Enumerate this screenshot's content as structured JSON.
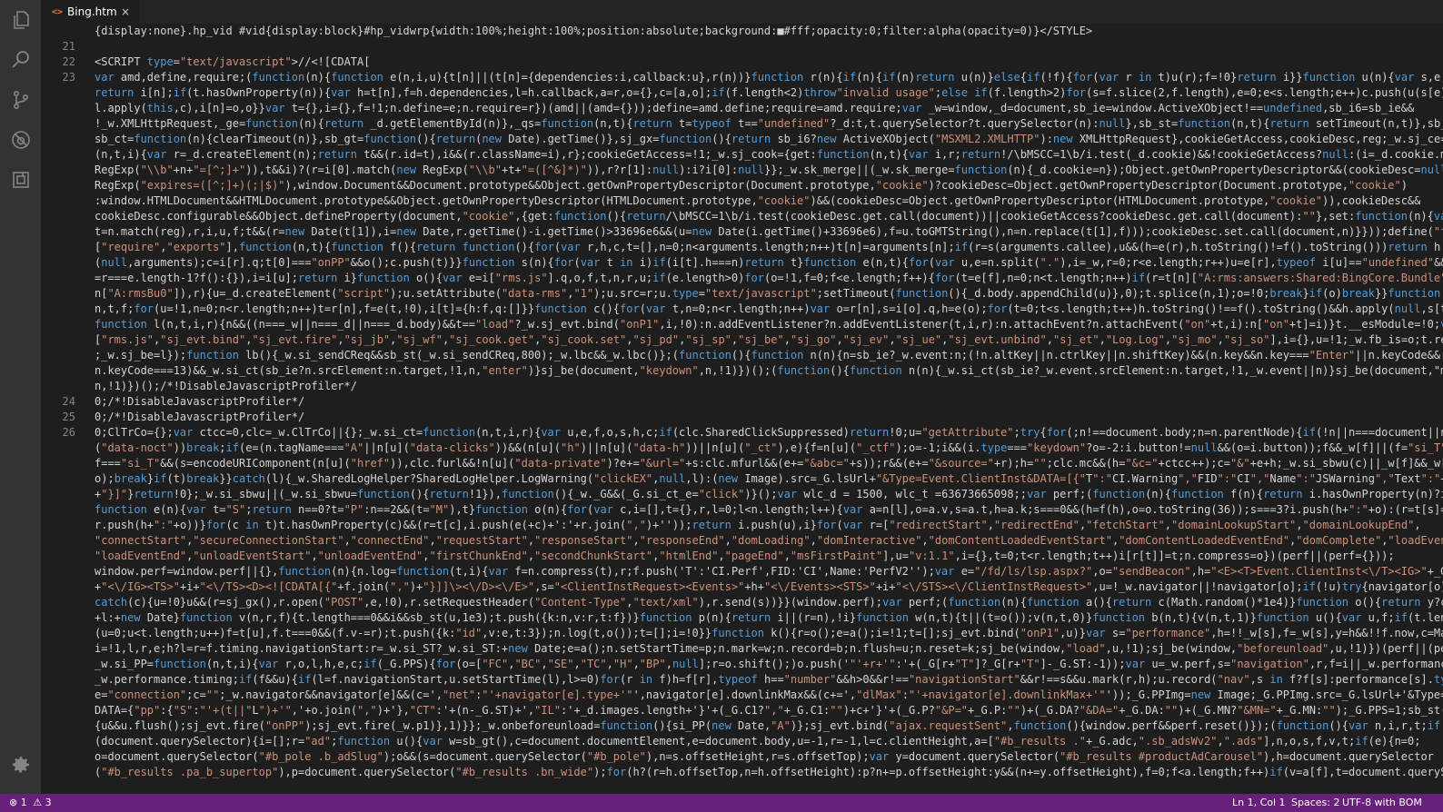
{
  "tab": {
    "file_icon": "<>",
    "name": "Bing.htm",
    "close": "×",
    "active": true
  },
  "activity_bar": {
    "items": [
      {
        "icon": "files-icon"
      },
      {
        "icon": "search-icon"
      },
      {
        "icon": "source-control-icon"
      },
      {
        "icon": "debug-icon"
      },
      {
        "icon": "extensions-icon"
      }
    ],
    "settings_icon": "gear-icon"
  },
  "editor": {
    "line_numbers": [
      "21",
      "22",
      "23",
      "24",
      "25",
      "26"
    ],
    "lines": [
      {
        "no": "",
        "text": "{display:none}.hp_vid #vid{display:block}#hp_vidwrp{width:100%;height:100%;position:absolute;background:■#fff;opacity:0;filter:alpha(opacity=0)}</STYLE>"
      },
      {
        "no": "21",
        "text": ""
      },
      {
        "no": "22",
        "text": "<SCRIPT type=\"text/javascript\">//<![CDATA["
      },
      {
        "no": "23",
        "text": "var amd,define,require;(function(n){function e(n,i,u){t[n]||(t[n]={dependencies:i,callback:u},r(n))}function r(n){if(n){if(n)return u(n)}else{if(!f){for(var r in t)u(r);f=!0}return i}}function u(n){var s,e;if(i[n])"
      },
      {
        "no": "",
        "text": "return i[n];if(t.hasOwnProperty(n)){var h=t[n],f=h.dependencies,l=h.callback,a=r,o={},c=[a,o];if(f.length<2)throw\"invalid usage\";else if(f.length>2)for(s=f.slice(2,f.length),e=0;e<s.length;e++)c.push(u(s[e]));retur"
      },
      {
        "no": "",
        "text": "l.apply(this,c),i[n]=o,o}}var t={},i={},f=!1;n.define=e;n.require=r})(amd||(amd={}));define=amd.define;require=amd.require;var _w=window,_d=document,sb_ie=window.ActiveXObject!==undefined,sb_i6=sb_ie&&"
      },
      {
        "no": "",
        "text": "!_w.XMLHttpRequest,_ge=function(n){return _d.getElementById(n)},_qs=function(n,t){return t=typeof t==\"undefined\"?_d:t,t.querySelector?t.querySelector(n):null},sb_st=function(n,t){return setTimeout(n,t)},sb_rst=sb_"
      },
      {
        "no": "",
        "text": "sb_ct=function(n){clearTimeout(n)},sb_gt=function(){return(new Date).getTime()},sj_gx=function(){return sb_i6?new ActiveXObject(\"MSXML2.XMLHTTP\"):new XMLHttpRequest},cookieGetAccess,cookieDesc,reg;_w.sj_ce=function"
      },
      {
        "no": "",
        "text": "(n,t,i){var r=_d.createElement(n);return t&&(r.id=t),i&&(r.className=i),r};cookieGetAccess=!1;_w.sj_cook={get:function(n,t){var i,r;return!/\\bMSCC=1\\b/i.test(_d.cookie)&&!cookieGetAccess?null:(i=_d.cookie.match(new"
      },
      {
        "no": "",
        "text": "RegExp(\"\\\\b\"+n+\"=[^;]+\")),t&&i)?(r=i[0].match(new RegExp(\"\\\\b\"+t+\"=([^&]*)\")),r?r[1]:null):i?i[0]:null}};_w.sk_merge||(_w.sk_merge=function(n){_d.cookie=n});Object.getOwnPropertyDescriptor&&(cookieDesc=null,reg=new"
      },
      {
        "no": "",
        "text": "RegExp(\"expires=([^;]+)(;|$)\"),window.Document&&Document.prototype&&Object.getOwnPropertyDescriptor(Document.prototype,\"cookie\")?cookieDesc=Object.getOwnPropertyDescriptor(Document.prototype,\"cookie\")"
      },
      {
        "no": "",
        "text": ":window.HTMLDocument&&HTMLDocument.prototype&&Object.getOwnPropertyDescriptor(HTMLDocument.prototype,\"cookie\")&&(cookieDesc=Object.getOwnPropertyDescriptor(HTMLDocument.prototype,\"cookie\")),cookieDesc&&"
      },
      {
        "no": "",
        "text": "cookieDesc.configurable&&Object.defineProperty(document,\"cookie\",{get:function(){return/\\bMSCC=1\\b/i.test(cookieDesc.get.call(document))||cookieGetAccess?cookieDesc.get.call(document):\"\"},set:function(n){var"
      },
      {
        "no": "",
        "text": "t=n.match(reg),r,i,u,f;t&&(r=new Date(t[1]),i=new Date,r.getTime()-i.getTime()>33696e6&&(u=new Date(i.getTime()+33696e6),f=u.toGMTString(),n=n.replace(t[1],f)));cookieDesc.set.call(document,n)}}));define(\"fallback\""
      },
      {
        "no": "",
        "text": "[\"require\",\"exports\"],function(n,t){function f(){return function(){for(var r,h,c,t=[],n=0;n<arguments.length;n++)t[n]=arguments[n];if(r=s(arguments.callee),u&&(h=e(r),h.toString()!=f().toString()))return h.apply"
      },
      {
        "no": "",
        "text": "(null,arguments);c=i[r].q;t[0]===\"onPP\"&&o();c.push(t)}}function s(n){for(var t in i)if(i[t].h===n)return t}function e(n,t){for(var u,e=n.split(\".\"),i=_w,r=0;r<e.length;r++)u=e[r],typeof i[u]==\"undefined\"&&t&&(i[u]"
      },
      {
        "no": "",
        "text": "=r===e.length-1?f():{}),i=i[u];return i}function o(){var e=i[\"rms.js\"].q,o,f,t,n,r,u;if(e.length>0)for(o=!1,f=0;f<e.length;f++){for(t=e[f],n=0;n<t.length;n++)if(r=t[n][\"A:rms:answers:Shared:BingCore.Bundle\"],r||(r="
      },
      {
        "no": "",
        "text": "n[\"A:rmsBu0\"]),r){u=_d.createElement(\"script\");u.setAttribute(\"data-rms\",\"1\");u.src=r;u.type=\"text/javascript\";setTimeout(function(){_d.body.appendChild(u)},0);t.splice(n,1);o=!0;break}if(o)break}}function h(){va"
      },
      {
        "no": "",
        "text": "n,t,f;for(u=!1,n=0;n<r.length;n++)t=r[n],f=e(t,!0),i[t]={h:f,q:[]}}function c(){for(var t,n=0;n<r.length;n++)var o=r[n],s=i[o].q,h=e(o);for(t=0;t<s.length;t++)h.toString()!==f().toString()&&h.apply(null,s[t])}u=!0"
      },
      {
        "no": "",
        "text": "function l(n,t,i,r){n&&((n===_w||n===_d||n===_d.body)&&t==\"load\"?_w.sj_evt.bind(\"onP1\",i,!0):n.addEventListener?n.addEventListener(t,i,r):n.attachEvent?n.attachEvent(\"on\"+t,i):n[\"on\"+t]=i)}t.__esModule=!0;var r="
      },
      {
        "no": "",
        "text": "[\"rms.js\",\"sj_evt.bind\",\"sj_evt.fire\",\"sj_jb\",\"sj_wf\",\"sj_cook.get\",\"sj_cook.set\",\"sj_pd\",\"sj_sp\",\"sj_be\",\"sj_go\",\"sj_ev\",\"sj_ue\",\"sj_evt.unbind\",\"sj_et\",\"Log.Log\",\"sj_mo\",\"sj_so\"],i={},u=!1;_w.fb_is=o;t.replay=c;h"
      },
      {
        "no": "",
        "text": ";_w.sj_be=l});function lb(){_w.si_sendCReq&&sb_st(_w.si_sendCReq,800);_w.lbc&&_w.lbc()};(function(){function n(n){n=sb_ie?_w.event:n;(!n.altKey||n.ctrlKey||n.shiftKey)&&(n.key&&n.key===\"Enter\"||n.keyCode&&"
      },
      {
        "no": "",
        "text": "n.keyCode===13)&&_w.si_ct(sb_ie?n.srcElement:n.target,!1,n,\"enter\")}sj_be(document,\"keydown\",n,!1)})();(function(){function n(n){_w.si_ct(sb_ie?_w.event.srcElement:n.target,!1,_w.event||n)}sj_be(document,\"mousedown"
      },
      {
        "no": "",
        "text": "n,!1)})();/*!DisableJavascriptProfiler*/"
      },
      {
        "no": "24",
        "text": "0;/*!DisableJavascriptProfiler*/"
      },
      {
        "no": "25",
        "text": "0;/*!DisableJavascriptProfiler*/"
      },
      {
        "no": "26",
        "text": "0;ClTrCo={};var ctcc=0,clc=_w.ClTrCo||{};_w.si_ct=function(n,t,i,r){var u,e,f,o,s,h,c;if(clc.SharedClickSuppressed)return!0;u=\"getAttribute\";try{for(;n!==document.body;n=n.parentNode){if(!n||n===document||n[u]"
      },
      {
        "no": "",
        "text": "(\"data-noct\"))break;if(e=(n.tagName===\"A\"||n[u](\"data-clicks\"))&&(n[u](\"h\")||n[u](\"data-h\"))||n[u](\"_ct\"),e){f=n[u](\"_ctf\");o=-1;i&&(i.type===\"keydown\"?o=-2:i.button!=null&&(o=i.button));f&&_w[f]||(f=\"si_T\");"
      },
      {
        "no": "",
        "text": "f===\"si_T\"&&(s=encodeURIComponent(n[u](\"href\")),clc.furl&&!n[u](\"data-private\")?e+=\"&url=\"+s:clc.mfurl&&(e+=\"&abc=\"+s));r&&(e+=\"&source=\"+r);h=\"\";clc.mc&&(h=\"&c=\"+ctcc++);c=\"&\"+e+h;_w.si_sbwu(c)||_w[f]&&_w[f](c,n,i"
      },
      {
        "no": "",
        "text": "o);break}if(t)break}}catch(l){_w.SharedLogHelper?SharedLogHelper.LogWarning(\"clickEX\",null,l):(new Image).src=_G.lsUrl+\"&Type=Event.ClientInst&DATA=[{\"T\":\"CI.Warning\",\"FID\":\"CI\",\"Name\":\"JSWarning\",\"Text\":\"+l.messag"
      },
      {
        "no": "",
        "text": "+\"}]\"}return!0};_w.si_sbwu||(_w.si_sbwu=function(){return!1}),function(){_w._G&&(_G.si_ct_e=\"click\")}();var wlc_d = 1500, wlc_t =63673665098;;var perf;(function(n){function f(n){return i.hasOwnProperty(n)?i[n]:n}"
      },
      {
        "no": "",
        "text": "function e(n){var t=\"S\";return n==0?t=\"P\":n==2&&(t=\"M\"),t}function o(n){for(var c,i=[],t={},r,l=0;l<n.length;l++){var a=n[l],o=a.v,s=a.t,h=a.k;s===0&&(h=f(h),o=o.toString(36));s===3?i.push(h+\":\"+o):(r=t[s]=t[s]||[]"
      },
      {
        "no": "",
        "text": "r.push(h+\":\"+o))}for(c in t)t.hasOwnProperty(c)&&(r=t[c],i.push(e(+c)+':'+r.join(\",\")+''));return i.push(u),i}for(var r=[\"redirectStart\",\"redirectEnd\",\"fetchStart\",\"domainLookupStart\",\"domainLookupEnd\","
      },
      {
        "no": "",
        "text": "\"connectStart\",\"secureConnectionStart\",\"connectEnd\",\"requestStart\",\"responseStart\",\"responseEnd\",\"domLoading\",\"domInteractive\",\"domContentLoadedEventStart\",\"domContentLoadedEventEnd\",\"domComplete\",\"loadEventStart\","
      },
      {
        "no": "",
        "text": "\"loadEventEnd\",\"unloadEventStart\",\"unloadEventEnd\",\"firstChunkEnd\",\"secondChunkStart\",\"htmlEnd\",\"pageEnd\",\"msFirstPaint\"],u=\"v:1.1\",i={},t=0;t<r.length;t++)i[r[t]]=t;n.compress=o})(perf||(perf={}));"
      },
      {
        "no": "",
        "text": "window.perf=window.perf||{},function(n){n.log=function(t,i){var f=n.compress(t),r;f.push('T':'CI.Perf',FID:'CI',Name:'PerfV2'');var e=\"/fd/ls/lsp.aspx?\",o=\"sendBeacon\",h=\"<E><T>Event.ClientInst<\\/T><IG>\"+_G.IG"
      },
      {
        "no": "",
        "text": "+\"<\\/IG><TS>\"+i+\"<\\/TS><D><![CDATA[{\"+f.join(\",\")+\"}]]\\><\\/D><\\/E>\",s=\"<ClientInstRequest><Events>\"+h+\"<\\/Events><STS>\"+i+\"<\\/STS><\\/ClientInstRequest>\",u=!_w.navigator||!navigator[o];if(!u)try{navigator[o](e,s)}"
      },
      {
        "no": "",
        "text": "catch(c){u=!0}u&&(r=sj_gx(),r.open(\"POST\",e,!0),r.setRequestHeader(\"Content-Type\",\"text/xml\"),r.send(s))}}(window.perf);var perf;(function(n){function a(){return c(Math.random()*1e4)}function o(){return y?c(f.now()"
      },
      {
        "no": "",
        "text": "+l:+new Date}function v(n,r,f){t.length===0&&i&&sb_st(u,1e3);t.push({k:n,v:r,t:f})}function p(n){return i||(r=n),!i}function w(n,t){t||(t=o());v(n,t,0)}function b(n,t){v(n,t,1)}function u(){var u,f;if(t.length){fo"
      },
      {
        "no": "",
        "text": "(u=0;u<t.length;u++)f=t[u],f.t===0&&(f.v-=r);t.push({k:\"id\",v:e,t:3});n.log(t,o());t=[];i=!0}}function k(){r=o();e=a();i=!1;t=[];sj_evt.bind(\"onP1\",u)}var s=\"performance\",h=!!_w[s],f=_w[s],y=h&&!!f.now,c=Math.round,t="
      },
      {
        "no": "",
        "text": "i=!1,l,r,e;h?l=r=f.timing.navigationStart:r=_w.si_ST?_w.si_ST:+new Date;e=a();n.setStartTime=p;n.mark=w;n.record=b;n.flush=u;n.reset=k;sj_be(window,\"load\",u,!1);sj_be(window,\"beforeunload\",u,!1)})(perf||(perf={}));"
      },
      {
        "no": "",
        "text": "_w.si_PP=function(n,t,i){var r,o,l,h,e,c;if(_G.PPS){for(o=[\"FC\",\"BC\",\"SE\",\"TC\",\"H\",\"BP\",null];r=o.shift();)o.push('\"'+r+'\":'+(_G[r+\"T\"]?_G[r+\"T\"]-_G.ST:-1));var u=_w.perf,s=\"navigation\",r,f=i||_w.performance&&"
      },
      {
        "no": "",
        "text": "_w.performance.timing;if(f&&u){if(l=f.navigationStart,u.setStartTime(l),l>=0)for(r in f)h=f[r],typeof h==\"number\"&&h>0&&r!==\"navigationStart\"&&r!==s&&u.mark(r,h);u.record(\"nav\",s in f?f[s]:performance[s].type)}"
      },
      {
        "no": "",
        "text": "e=\"connection\";c=\"\";_w.navigator&&navigator[e]&&(c=',\"net\":\"'+navigator[e].type+'\"',navigator[e].downlinkMax&&(c+=',\"dlMax\":\"'+navigator[e].downlinkMax+'\"'));_G.PPImg=new Image;_G.PPImg.src=_G.lsUrl+'&Type=Event.CP"
      },
      {
        "no": "",
        "text": "DATA={\"pp\":{\"S\":\"'+(t||\"L\")+'\",'+o.join(\",\")+'},\"CT\":'+(n-_G.ST)+',\"IL\":'+_d.images.length+'}'+(_G.C1?\",\"+_G.C1:\"\")+c+'}'+(_G.P?\"&P=\"+_G.P:\"\")+(_G.DA?\"&DA=\"+_G.DA:\"\")+(_G.MN?\"&MN=\"+_G.MN:\"\");_G.PPS=1;sb_st(function("
      },
      {
        "no": "",
        "text": "{u&&u.flush();sj_evt.fire(\"onPP\");sj_evt.fire(_w.p1)},1)}};_w.onbeforeunload=function(){si_PP(new Date,\"A\")};sj_evt.bind(\"ajax.requestSent\",function(){window.perf&&perf.reset()});(function(){var n,i,r,t;if"
      },
      {
        "no": "",
        "text": "(document.querySelector){i=[];r=\"ad\";function u(){var w=sb_gt(),c=document.documentElement,e=document.body,u=-1,r=-1,l=c.clientHeight,a=[\"#b_results .\"+_G.adc,\".sb_adsWv2\",\".ads\"],n,o,s,f,v,t;if(e){n=0;"
      },
      {
        "no": "",
        "text": "o=document.querySelector(\"#b_pole .b_adSlug\");o&&(s=document.querySelector(\"#b_pole\"),n=s.offsetHeight,r=s.offsetTop);var y=document.querySelector(\"#b_results #productAdCarousel\"),h=document.querySelector"
      },
      {
        "no": "",
        "text": "(\"#b_results .pa_b_supertop\"),p=document.querySelector(\"#b_results .bn_wide\");for(h?(r=h.offsetTop,n=h.offsetHeight):p?n+=p.offsetHeight:y&&(n+=y.offsetHeight),f=0;f<a.length;f++)if(v=a[f],t=document.querySelector"
      }
    ]
  },
  "status_bar": {
    "errors": "1",
    "warnings": "3",
    "position": "Ln 1, Col 1",
    "spaces": "Spaces: 2",
    "encoding": "UTF-8 with BOM"
  },
  "colors": {
    "activity_bar": "#333333",
    "editor_bg": "#1e1e1e",
    "status_bar": "#68217a",
    "keyword": "#569cd6",
    "string": "#ce9178"
  }
}
